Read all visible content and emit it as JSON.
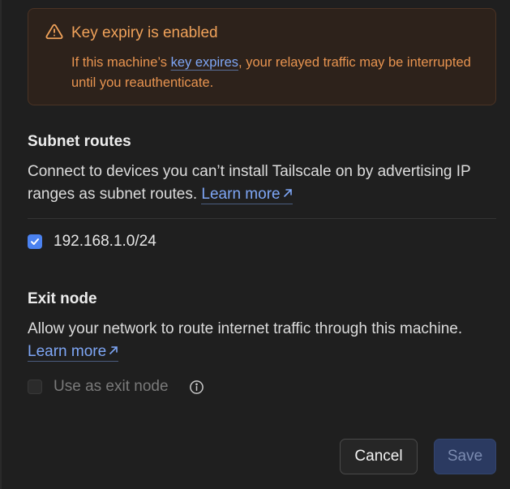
{
  "warning": {
    "title": "Key expiry is enabled",
    "body_before": "If this machine’s ",
    "body_link": "key expires",
    "body_after": ", your relayed traffic may be interrupted until you reauthenticate.",
    "color": "#f0a25a",
    "icon": "warning-triangle-icon"
  },
  "subnet": {
    "title": "Subnet routes",
    "description": "Connect to devices you can’t install Tailscale on by advertising IP ranges as subnet routes. ",
    "learn_more": "Learn more",
    "routes": [
      {
        "label": "192.168.1.0/24",
        "checked": true
      }
    ]
  },
  "exit_node": {
    "title": "Exit node",
    "description": "Allow your network to route internet traffic through this machine. ",
    "learn_more": "Learn more",
    "option_label": "Use as exit node",
    "option_checked": false,
    "option_disabled": true,
    "info_icon": "info-icon"
  },
  "actions": {
    "cancel_label": "Cancel",
    "save_label": "Save",
    "save_disabled": true
  },
  "colors": {
    "background": "#1f1f1f",
    "accent": "#4b82f0",
    "link": "#7ea6f5",
    "warning": "#f0a25a"
  }
}
